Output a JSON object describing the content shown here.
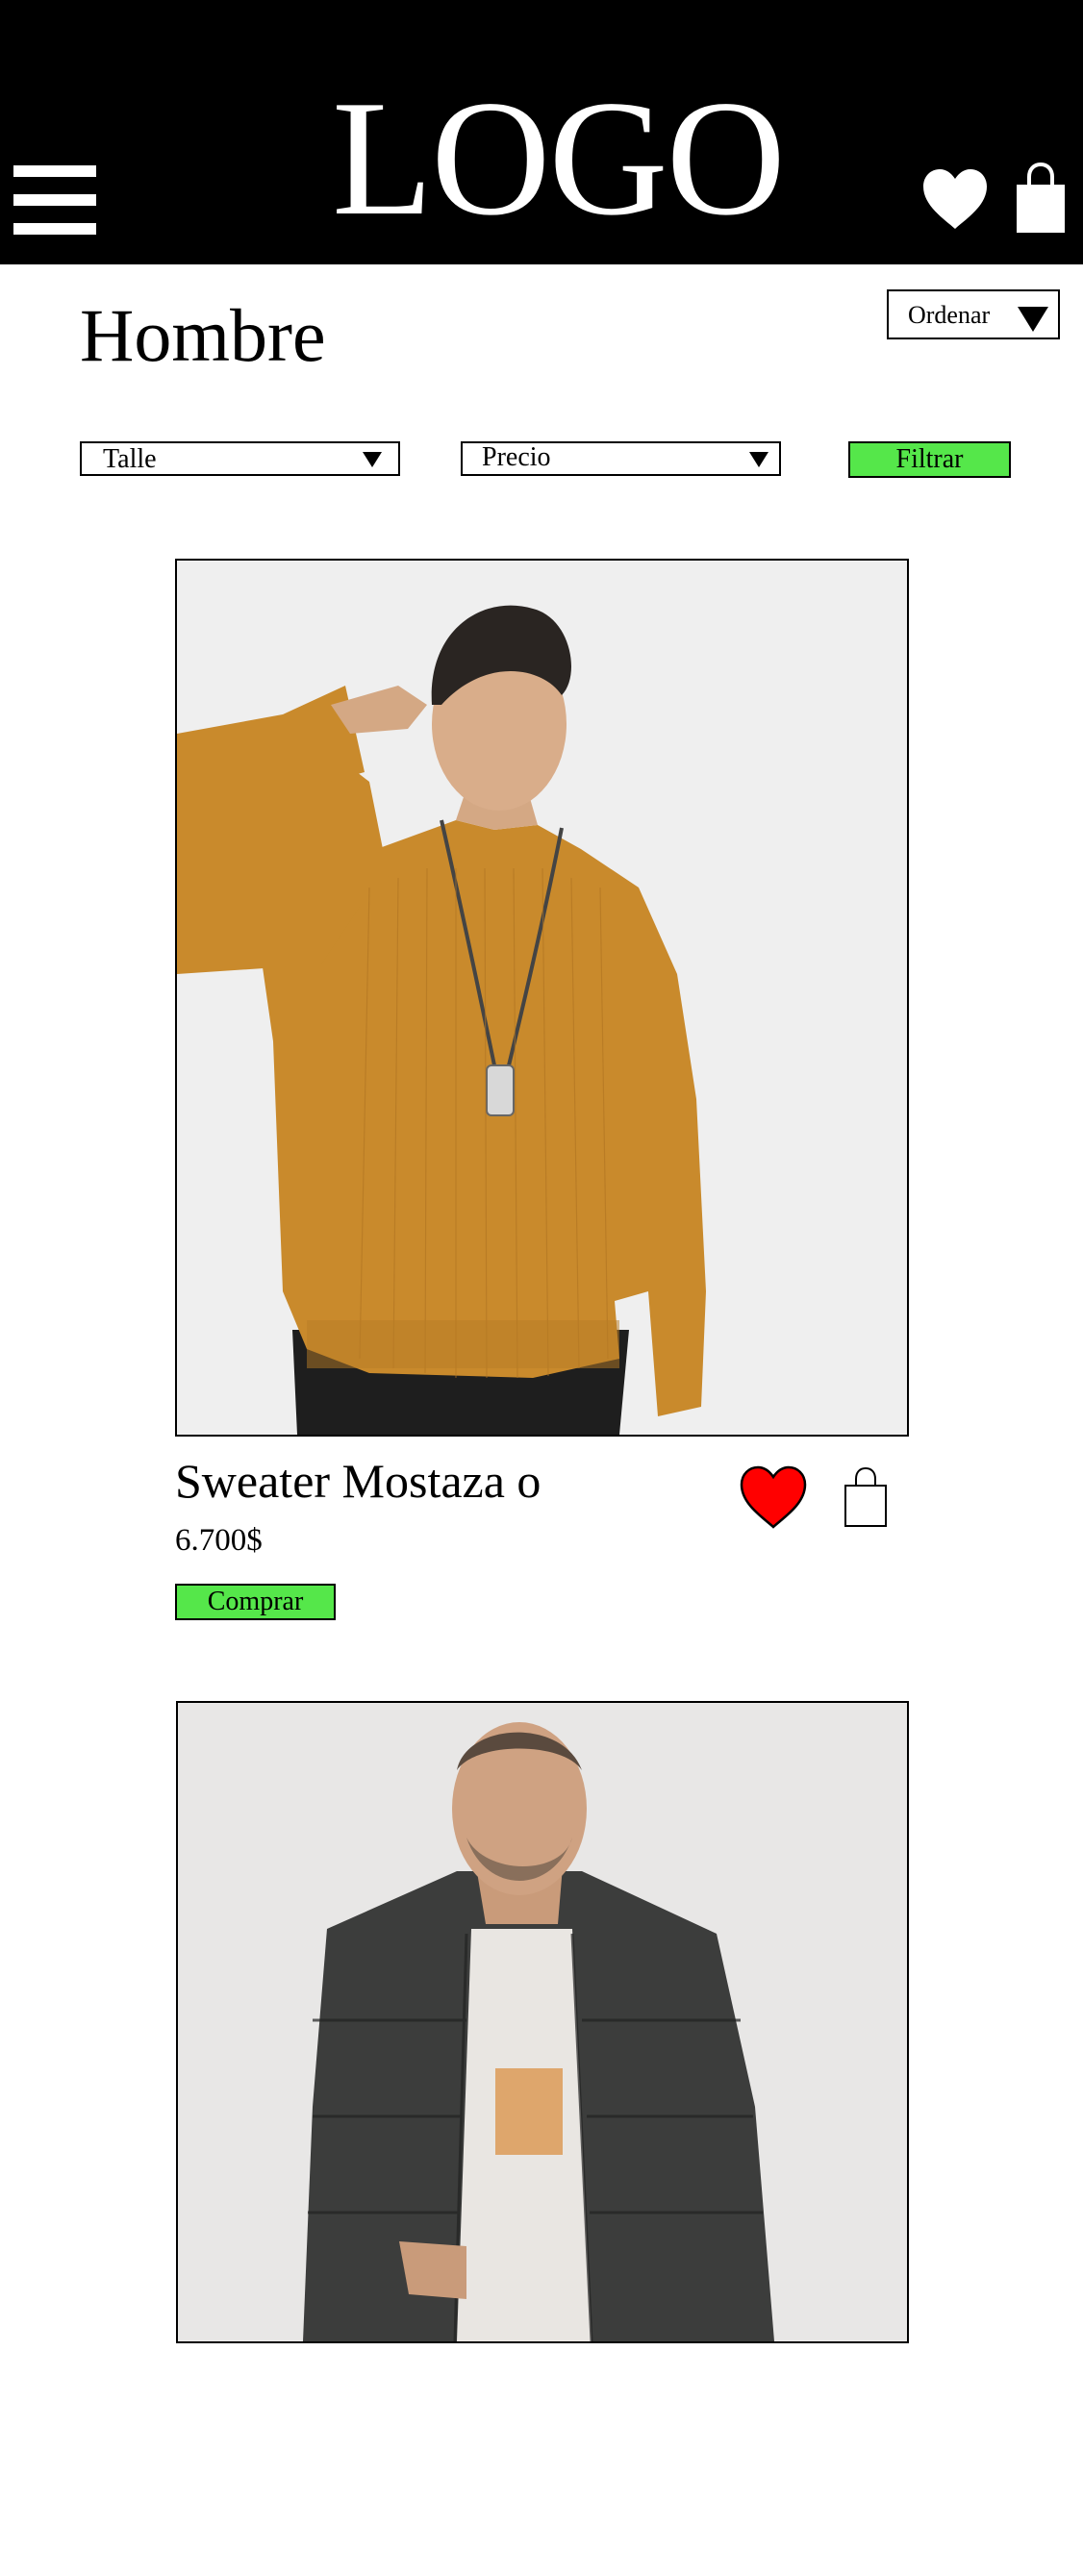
{
  "header": {
    "logo_text": "LOGO",
    "background": "#000000",
    "icons": [
      "menu-icon",
      "heart-icon",
      "shopping-bag-icon"
    ]
  },
  "page": {
    "title": "Hombre"
  },
  "sort": {
    "label": "Ordenar"
  },
  "filters": {
    "size_label": "Talle",
    "price_label": "Precio",
    "button_label": "Filtrar",
    "button_color": "#55e74a"
  },
  "products": [
    {
      "name": "Sweater Mostaza o",
      "price": "6.700$",
      "buy_label": "Comprar",
      "favorite": true,
      "favorite_color": "#ff0000",
      "image": "man in mustard ribbed sweater with dog tag necklace"
    },
    {
      "image": "man in dark camouflage puffer jacket over white graphic t-shirt"
    }
  ]
}
